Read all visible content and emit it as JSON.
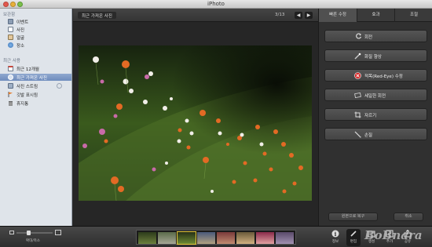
{
  "window": {
    "title": "iPhoto"
  },
  "sidebar": {
    "library_title": "보관함",
    "library_items": [
      {
        "label": "이벤트",
        "icon": "events-icon"
      },
      {
        "label": "사진",
        "icon": "photos-icon"
      },
      {
        "label": "얼굴",
        "icon": "faces-icon"
      },
      {
        "label": "장소",
        "icon": "places-icon"
      }
    ],
    "recent_title": "최근 사용",
    "recent_items": [
      {
        "label": "최근 12개월",
        "icon": "calendar-icon"
      },
      {
        "label": "최근 가져온 사진",
        "icon": "import-icon"
      },
      {
        "label": "사진 스트림",
        "icon": "photostream-icon"
      },
      {
        "label": "깃발 표시됨",
        "icon": "flag-icon"
      },
      {
        "label": "휴지통",
        "icon": "trash-icon"
      }
    ]
  },
  "main": {
    "event_label": "최근 가져온 사진",
    "counter": "3/13",
    "prev": "◀",
    "next": "▶"
  },
  "edit_panel": {
    "tabs": [
      "빠른 수정",
      "효과",
      "조절"
    ],
    "active_tab": 0,
    "tools": [
      {
        "label": "회전",
        "icon": "rotate-icon"
      },
      {
        "label": "화질 향상",
        "icon": "enhance-icon"
      },
      {
        "label": "적목(Red-Eye) 수정",
        "icon": "red-eye-icon"
      },
      {
        "label": "세일한 회전",
        "icon": "straighten-icon"
      },
      {
        "label": "자르기",
        "icon": "crop-icon"
      },
      {
        "label": "손질",
        "icon": "retouch-icon"
      }
    ],
    "revert_label": "원본으로 복구",
    "cancel_label": "취소"
  },
  "bottom": {
    "zoom_label": "확대/축소",
    "zoom_value": 0.3,
    "buttons": [
      {
        "label": "정보",
        "icon": "info-icon"
      },
      {
        "label": "편집",
        "icon": "edit-icon"
      },
      {
        "label": "생성",
        "icon": "create-icon"
      },
      {
        "label": "추가",
        "icon": "add-icon"
      },
      {
        "label": "공유",
        "icon": "share-icon"
      }
    ]
  },
  "watermark": "BoBnara"
}
